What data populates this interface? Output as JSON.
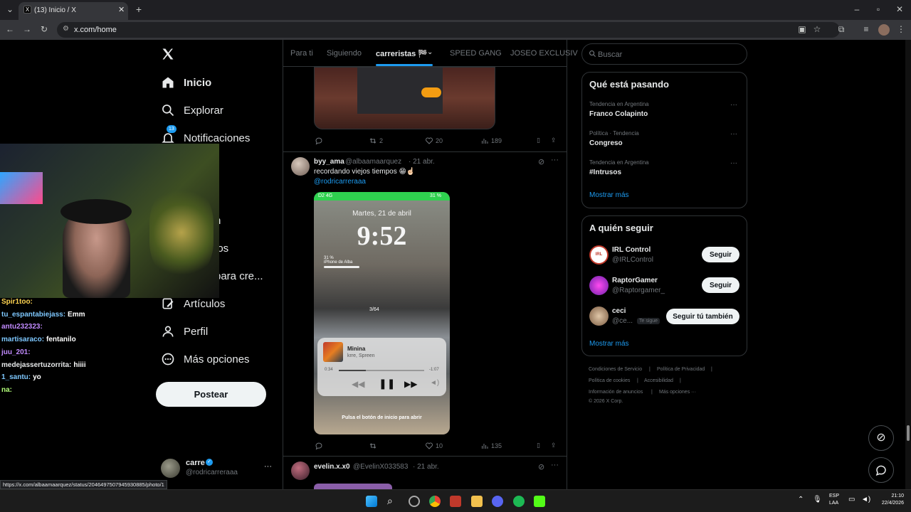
{
  "browser": {
    "tab_title": "(13) Inicio / X",
    "url": "x.com/home",
    "status_url": "https://x.com/albaamaarquez/status/2046497507945930885/photo/1"
  },
  "nav": {
    "logo": "X",
    "items": [
      {
        "label": "Inicio",
        "icon": "home-icon"
      },
      {
        "label": "Explorar",
        "icon": "search-icon"
      },
      {
        "label": "Notificaciones",
        "icon": "bell-icon",
        "badge": "13"
      },
      {
        "label": "n",
        "icon": "mail-icon"
      },
      {
        "label": "los",
        "icon": "list-icon"
      },
      {
        "label": "para cre...",
        "icon": "star-icon"
      },
      {
        "label": "Artículos",
        "icon": "article-icon"
      },
      {
        "label": "Perfil",
        "icon": "person-icon"
      },
      {
        "label": "Más opciones",
        "icon": "more-circle-icon"
      }
    ],
    "post_label": "Postear",
    "account": {
      "name": "carre",
      "handle": "@rodricarreraaa",
      "more": "···"
    }
  },
  "chat": [
    {
      "user": "Spir1too:",
      "msg": "",
      "color": "#ffd451"
    },
    {
      "user": "tu_espantabiejass:",
      "msg": "Emm",
      "color": "#7ec8ff"
    },
    {
      "user": "antu232323:",
      "msg": "",
      "color": "#c28bff"
    },
    {
      "user": "martisaraco:",
      "msg": "fentanilo",
      "color": "#7ec8ff"
    },
    {
      "user": "juu_201:",
      "msg": "",
      "color": "#c28bff"
    },
    {
      "user": "medejassertuzorrita:",
      "msg": "hiiii",
      "color": "#e7e9ea"
    },
    {
      "user": "1_santu:",
      "msg": "yo",
      "color": "#7ec8ff"
    },
    {
      "user": "na:",
      "msg": "",
      "color": "#b3ff7a"
    }
  ],
  "feed_tabs": [
    "Para ti",
    "Siguiendo",
    "carreristas 🏁",
    "SPEED GANG",
    "JOSEO EXCLUSIV"
  ],
  "tweet_top_actions": {
    "replies": "",
    "retweets": "2",
    "likes": "20",
    "views": "189"
  },
  "tweet": {
    "name": "byy_ama",
    "handle": "@albaamaarquez",
    "date": "· 21 abr.",
    "text": "recordando viejos tiempos 😁☝🏻",
    "mention": "@rodricarreraaa",
    "phone": {
      "status_left": "D2 4G",
      "status_right": "31 %",
      "date": "Martes, 21 de abril",
      "time": "9:52",
      "battery_pct": "31 %",
      "battery_label": "iPhone de Alba",
      "counter": "3/64",
      "song": "Minina",
      "artist": "krre, Spreen",
      "elapsed": "0:34",
      "remaining": "-1:07",
      "unlock_hint": "Pulsa el botón de inicio para abrir"
    },
    "actions": {
      "replies": "",
      "retweets": "",
      "likes": "10",
      "views": "135"
    }
  },
  "tweet2": {
    "name": "evelin.x.x0",
    "handle": "@EvelinX033583",
    "date": "· 21 abr."
  },
  "search_placeholder": "Buscar",
  "trends": {
    "title": "Qué está pasando",
    "items": [
      {
        "context": "Tendencia en Argentina",
        "name": "Franco Colapinto"
      },
      {
        "context": "Política · Tendencia",
        "name": "Congreso"
      },
      {
        "context": "Tendencia en Argentina",
        "name": "#Intrusos"
      }
    ],
    "more": "Mostrar más"
  },
  "follow": {
    "title": "A quién seguir",
    "items": [
      {
        "name": "IRL Control",
        "handle": "@IRLControl",
        "button": "Seguir",
        "badge": ""
      },
      {
        "name": "RaptorGamer",
        "handle": "@Raptorgamer_",
        "button": "Seguir",
        "badge": ""
      },
      {
        "name": "ceci",
        "handle": "@ce...",
        "button": "Seguir tú también",
        "badge": "Te sigue"
      }
    ],
    "more": "Mostrar más"
  },
  "footer": {
    "links": [
      "Condiciones de Servicio",
      "Política de Privacidad",
      "Política de cookies",
      "Accesibilidad",
      "Información de anuncios",
      "Más opciones ···"
    ],
    "copyright": "© 2026 X Corp."
  },
  "taskbar": {
    "lang": "ESP",
    "lang2": "LAA",
    "time": "21:10",
    "date": "22/4/2026"
  },
  "colors": {
    "accent": "#1d9bf0",
    "bg": "#000000",
    "border": "#2f3336",
    "muted": "#71767b"
  }
}
